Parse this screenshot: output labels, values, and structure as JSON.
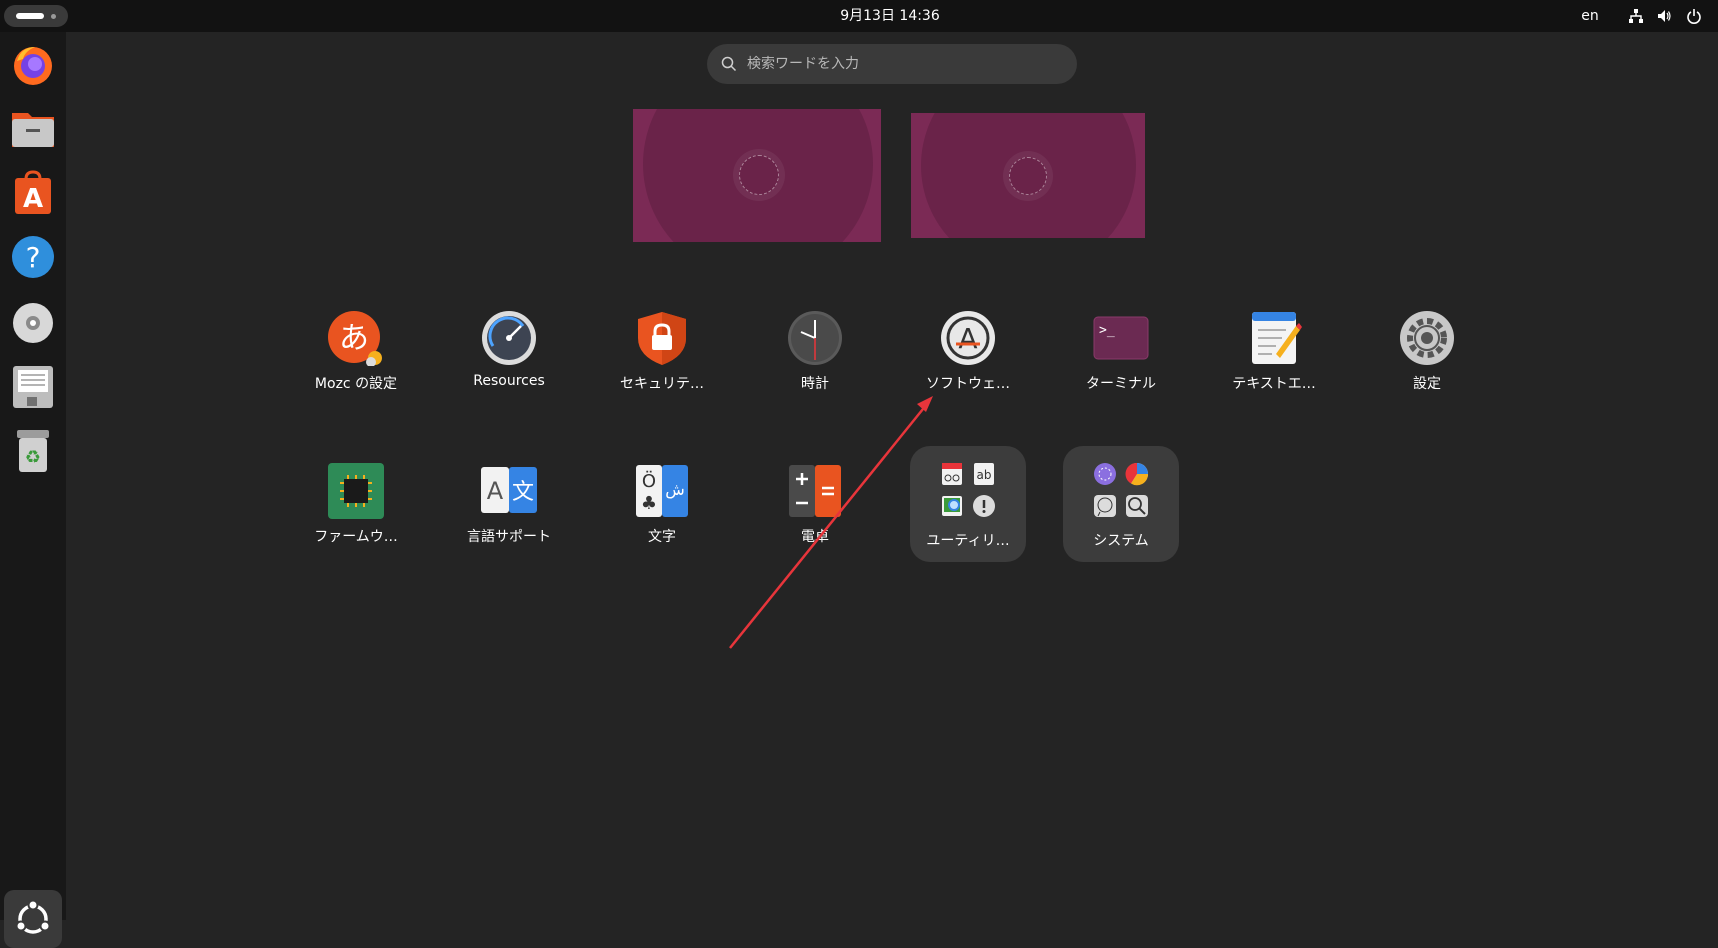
{
  "topbar": {
    "clock": "9月13日  14:36",
    "language": "en"
  },
  "search": {
    "placeholder": "検索ワードを入力"
  },
  "dock": {
    "items": [
      "firefox",
      "files",
      "app-center",
      "help",
      "disc",
      "disk-utility",
      "trash"
    ]
  },
  "apps": [
    {
      "label": "Mozc の設定",
      "icon": "mozc-icon"
    },
    {
      "label": "Resources",
      "icon": "resources-icon"
    },
    {
      "label": "セキュリテ…",
      "icon": "security-icon"
    },
    {
      "label": "時計",
      "icon": "clock-icon"
    },
    {
      "label": "ソフトウェ…",
      "icon": "software-updater-icon"
    },
    {
      "label": "ターミナル",
      "icon": "terminal-icon"
    },
    {
      "label": "テキストエ…",
      "icon": "text-editor-icon"
    },
    {
      "label": "設定",
      "icon": "settings-icon"
    },
    {
      "label": "ファームウ…",
      "icon": "firmware-icon"
    },
    {
      "label": "言語サポート",
      "icon": "language-support-icon"
    },
    {
      "label": "文字",
      "icon": "characters-icon"
    },
    {
      "label": "電卓",
      "icon": "calculator-icon"
    }
  ],
  "folders": [
    {
      "label": "ユーティリ…"
    },
    {
      "label": "システム"
    }
  ],
  "colors": {
    "background": "#242424",
    "topbar": "#121212",
    "dock": "#181818",
    "accent_orange": "#e95420",
    "wallpaper": "#7b2a55",
    "annotation_arrow": "#e8353b"
  }
}
